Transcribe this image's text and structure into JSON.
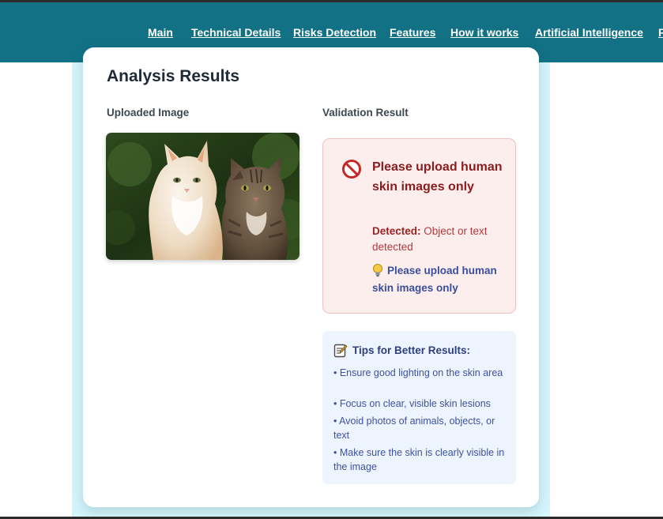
{
  "nav": {
    "links": [
      "Main",
      "Technical Details",
      "Risks Detection",
      "Features",
      "How it works",
      "Artificial Intelligence",
      "F"
    ]
  },
  "analysis": {
    "title": "Analysis Results",
    "uploaded_label": "Uploaded Image",
    "validation_label": "Validation Result"
  },
  "error": {
    "title": "Please upload human skin images only",
    "detected_label": "Detected:",
    "detected_value": "Object or text detected",
    "hint": "Please upload human skin images only"
  },
  "tips": {
    "title": "Tips for Better Results:",
    "items": [
      "• Ensure good lighting on the skin area",
      "• Focus on clear, visible skin lesions",
      "• Avoid photos of animals, objects, or text",
      "• Make sure the skin is clearly visible in the image"
    ]
  },
  "colors": {
    "navbar": "#127185",
    "page_background": "#d4f5fb",
    "error_background": "#fdeeee",
    "error_text": "#8b1c1c",
    "tips_background": "#eef4fd",
    "tips_text": "#3d52a0"
  }
}
